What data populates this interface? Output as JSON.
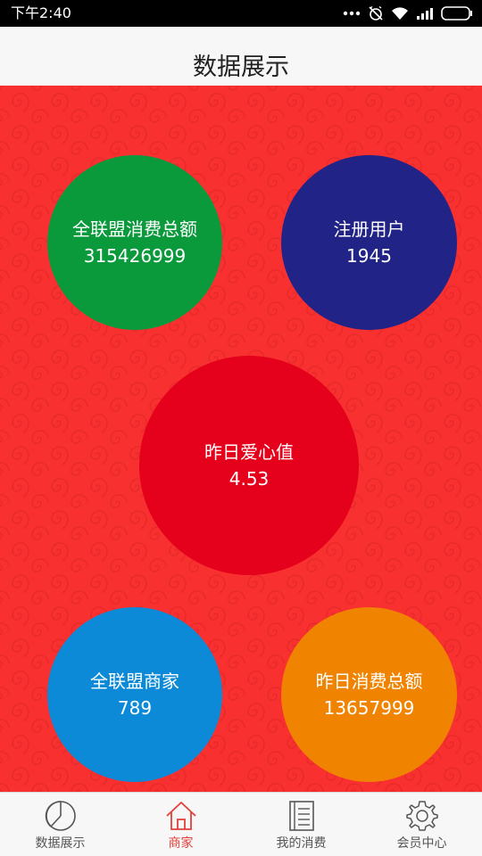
{
  "status_bar": {
    "time": "下午2:40"
  },
  "header": {
    "title": "数据展示"
  },
  "stats": {
    "total_consumption": {
      "label": "全联盟消费总额",
      "value": "315426999",
      "color": "#0a9a3c"
    },
    "registered_users": {
      "label": "注册用户",
      "value": "1945",
      "color": "#222387"
    },
    "yesterday_love": {
      "label": "昨日爱心值",
      "value": "4.53",
      "color": "#e5001c"
    },
    "merchants": {
      "label": "全联盟商家",
      "value": "789",
      "color": "#0c8ad8"
    },
    "yesterday_consumption": {
      "label": "昨日消费总额",
      "value": "13657999",
      "color": "#f08300"
    }
  },
  "bottom_nav": {
    "items": [
      {
        "label": "数据展示",
        "icon": "pie-chart-icon",
        "active": false
      },
      {
        "label": "商家",
        "icon": "home-icon",
        "active": true
      },
      {
        "label": "我的消费",
        "icon": "document-icon",
        "active": false
      },
      {
        "label": "会员中心",
        "icon": "gear-icon",
        "active": false
      }
    ]
  },
  "colors": {
    "background_red": "#f8302f",
    "active_tab": "#e2403a"
  }
}
